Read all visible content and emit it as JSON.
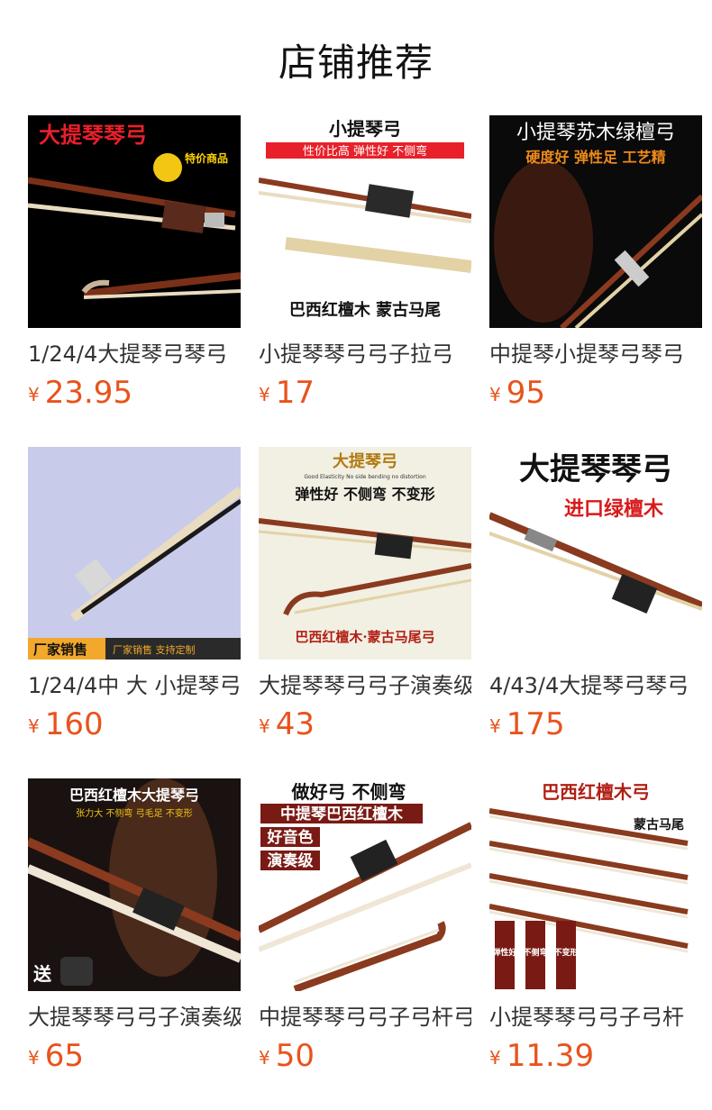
{
  "header": {
    "title": "店铺推荐"
  },
  "currency": "¥",
  "products": [
    {
      "name": "1/24/4大提琴弓琴弓",
      "price": "23.95",
      "img_text": [
        "大提琴琴弓",
        "特价商品"
      ]
    },
    {
      "name": "小提琴琴弓弓子拉弓",
      "price": "17",
      "img_text": [
        "小提琴弓",
        "性价比高 弹性好 不侧弯",
        "巴西红檀木 蒙古马尾"
      ]
    },
    {
      "name": "中提琴小提琴弓琴弓",
      "price": "95",
      "img_text": [
        "小提琴苏木绿檀弓",
        "硬度好 弹性足 工艺精"
      ]
    },
    {
      "name": "1/24/4中 大 小提琴弓",
      "price": "160",
      "img_text": [
        "厂家销售",
        "厂家销售 支持定制"
      ]
    },
    {
      "name": "大提琴琴弓弓子演奏级",
      "price": "43",
      "img_text": [
        "大提琴弓",
        "Good Elasticity No side bending no distortion",
        "弹性好 不侧弯 不变形",
        "巴西红檀木·蒙古马尾弓"
      ]
    },
    {
      "name": "4/43/4大提琴弓琴弓",
      "price": "175",
      "img_text": [
        "大提琴琴弓",
        "进口绿檀木"
      ]
    },
    {
      "name": "大提琴琴弓弓子演奏级",
      "price": "65",
      "img_text": [
        "巴西红檀木大提琴弓",
        "张力大 不侧弯 弓毛足 不变形",
        "送"
      ]
    },
    {
      "name": "中提琴琴弓弓子弓杆弓",
      "price": "50",
      "img_text": [
        "做好弓 不侧弯",
        "中提琴巴西红檀木",
        "好音色",
        "演奏级"
      ]
    },
    {
      "name": "小提琴琴弓弓子弓杆",
      "price": "11.39",
      "img_text": [
        "巴西红檀木弓",
        "蒙古马尾",
        "弹性好",
        "不侧弯",
        "不变形"
      ]
    }
  ],
  "colors": {
    "price": "#e8531c",
    "title": "#111111",
    "name": "#333333"
  }
}
